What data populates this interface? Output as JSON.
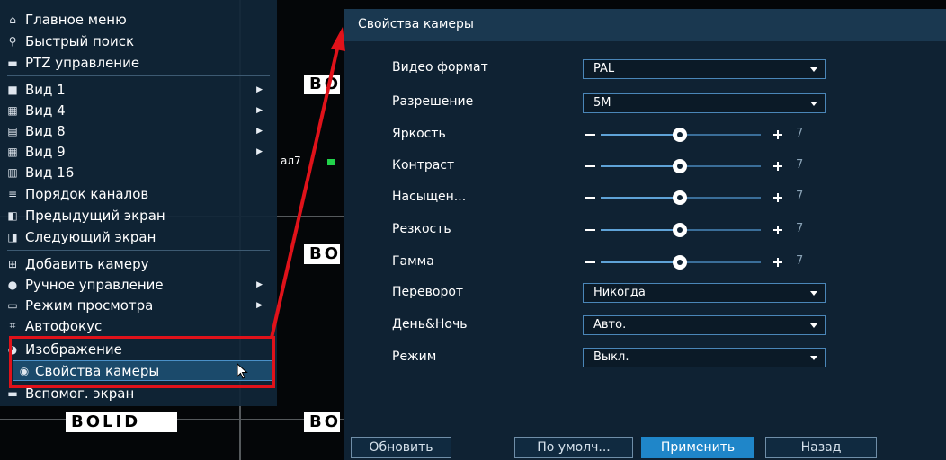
{
  "background": {
    "brand_logo": "BOLID",
    "channel_label": "ал7"
  },
  "context_menu": {
    "items": [
      {
        "label": "Главное меню",
        "icon": "home-icon"
      },
      {
        "label": "Быстрый поиск",
        "icon": "search-icon"
      },
      {
        "label": "PTZ управление",
        "icon": "ptz-icon"
      },
      {
        "label": "Вид 1",
        "icon": "view-1-icon",
        "submenu": true
      },
      {
        "label": "Вид 4",
        "icon": "view-4-icon",
        "submenu": true
      },
      {
        "label": "Вид 8",
        "icon": "view-8-icon",
        "submenu": true
      },
      {
        "label": "Вид 9",
        "icon": "view-9-icon",
        "submenu": true
      },
      {
        "label": "Вид 16",
        "icon": "view-16-icon"
      },
      {
        "label": "Порядок каналов",
        "icon": "channel-order-icon"
      },
      {
        "label": "Предыдущий экран",
        "icon": "previous-screen-icon"
      },
      {
        "label": "Следующий экран",
        "icon": "next-screen-icon"
      },
      {
        "label": "Добавить камеру",
        "icon": "add-camera-icon"
      },
      {
        "label": "Ручное управление",
        "icon": "manual-control-icon",
        "submenu": true
      },
      {
        "label": "Режим просмотра",
        "icon": "view-mode-icon",
        "submenu": true
      },
      {
        "label": "Автофокус",
        "icon": "autofocus-icon"
      },
      {
        "label": "Изображение",
        "icon": "image-icon"
      },
      {
        "label": "Свойства камеры",
        "icon": "camera-icon",
        "selected": true
      },
      {
        "label": "Вспомог. экран",
        "icon": "aux-screen-icon"
      }
    ]
  },
  "dialog": {
    "title": "Свойства камеры",
    "fields": {
      "video_format": {
        "label": "Видео формат",
        "value": "PAL"
      },
      "resolution": {
        "label": "Разрешение",
        "value": "5M"
      },
      "brightness": {
        "label": "Яркость",
        "value": "7"
      },
      "contrast": {
        "label": "Контраст",
        "value": "7"
      },
      "saturation": {
        "label": "Насыщен...",
        "value": "7"
      },
      "sharpness": {
        "label": "Резкость",
        "value": "7"
      },
      "gamma": {
        "label": "Гамма",
        "value": "7"
      },
      "flip": {
        "label": "Переворот",
        "value": "Никогда"
      },
      "day_night": {
        "label": "День&Ночь",
        "value": "Авто."
      },
      "mode": {
        "label": "Режим",
        "value": "Выкл."
      }
    },
    "buttons": {
      "refresh": "Обновить",
      "default": "По умолч...",
      "apply": "Применить",
      "back": "Назад"
    }
  },
  "colors": {
    "highlight": "#e0121a",
    "accent": "#1f86c9",
    "menu_bg": "#102638",
    "dialog_bg": "#0f2233"
  }
}
